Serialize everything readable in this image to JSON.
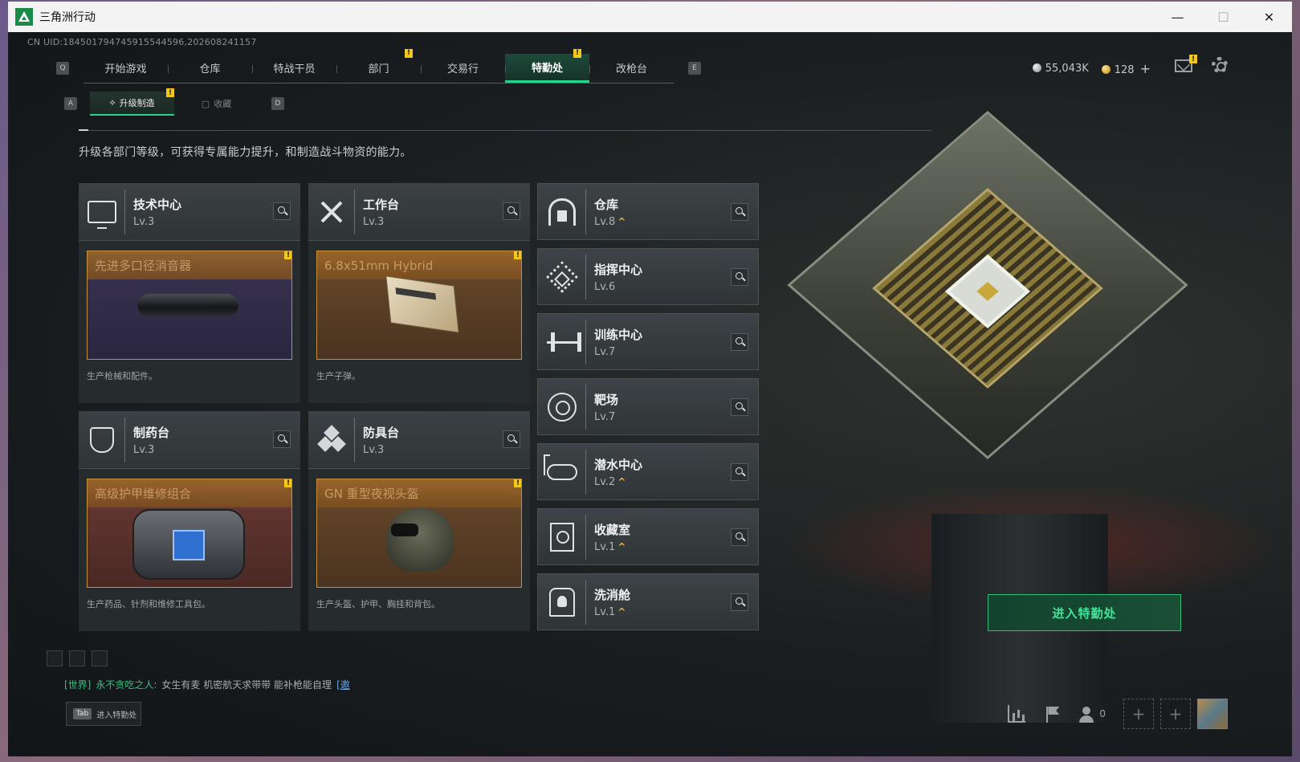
{
  "window": {
    "title": "三角洲行动",
    "minimize": "—",
    "maximize": "☐",
    "close": "✕"
  },
  "uid": "CN UID:18450179474591554459​6,202608241157",
  "nav": {
    "left_key": "Q",
    "right_key": "E",
    "tabs": [
      {
        "label": "开始游戏",
        "badge": ""
      },
      {
        "label": "仓库",
        "badge": ""
      },
      {
        "label": "特战干员",
        "badge": ""
      },
      {
        "label": "部门",
        "badge": "!"
      },
      {
        "label": "交易行",
        "badge": ""
      },
      {
        "label": "特勤处",
        "badge": "!",
        "active": true
      },
      {
        "label": "改枪台",
        "badge": ""
      }
    ]
  },
  "currency": {
    "silver": "55,043K",
    "gold": "128",
    "plus": "+"
  },
  "mail_badge": "!",
  "subnav": {
    "left_key": "A",
    "right_key": "D",
    "tabs": [
      {
        "label": "升级制造",
        "active": true,
        "badge": "!"
      },
      {
        "label": "收藏",
        "active": false
      }
    ]
  },
  "description": "升级各部门等级，可获得专属能力提升，和制造战斗物资的能力。",
  "production": [
    {
      "name": "技术中心",
      "level": "Lv.3",
      "item": "先进多口径消音器",
      "footer": "生产枪械和配件。",
      "badge": "!"
    },
    {
      "name": "工作台",
      "level": "Lv.3",
      "item": "6.8x51mm Hybrid",
      "footer": "生产子弹。",
      "badge": "!"
    },
    {
      "name": "制药台",
      "level": "Lv.3",
      "item": "高级护甲维修组合",
      "footer": "生产药品、针剂和维修工具包。",
      "badge": "!"
    },
    {
      "name": "防具台",
      "level": "Lv.3",
      "item": "GN 重型夜视头盔",
      "footer": "生产头盔、护甲、胸挂和背包。",
      "badge": "!"
    }
  ],
  "modules": [
    {
      "name": "仓库",
      "level": "Lv.8",
      "upgradable": "^",
      "icon": "warehouse-icon"
    },
    {
      "name": "指挥中心",
      "level": "Lv.6",
      "upgradable": "",
      "icon": "command-icon"
    },
    {
      "name": "训练中心",
      "level": "Lv.7",
      "upgradable": "",
      "icon": "dumbbell-icon"
    },
    {
      "name": "靶场",
      "level": "Lv.7",
      "upgradable": "",
      "icon": "target-icon"
    },
    {
      "name": "潜水中心",
      "level": "Lv.2",
      "upgradable": "^",
      "icon": "goggles-icon"
    },
    {
      "name": "收藏室",
      "level": "Lv.1",
      "upgradable": "^",
      "icon": "vault-icon"
    },
    {
      "name": "洗消舱",
      "level": "Lv.1",
      "upgradable": "^",
      "icon": "hazmat-icon"
    }
  ],
  "enter_button": "进入特勤处",
  "chat": {
    "channel": "[世界]",
    "sender": "永不贪吃之人:",
    "message": "女生有麦  机密航天求带带  能补枪能自理",
    "link": "[邀"
  },
  "tab_hint": {
    "key": "Tab",
    "label": "进入特勤处"
  },
  "friends_count": "0",
  "colors": {
    "accent": "#29d38b",
    "badge": "#f3c81e",
    "item_border": "#c88f3b"
  }
}
